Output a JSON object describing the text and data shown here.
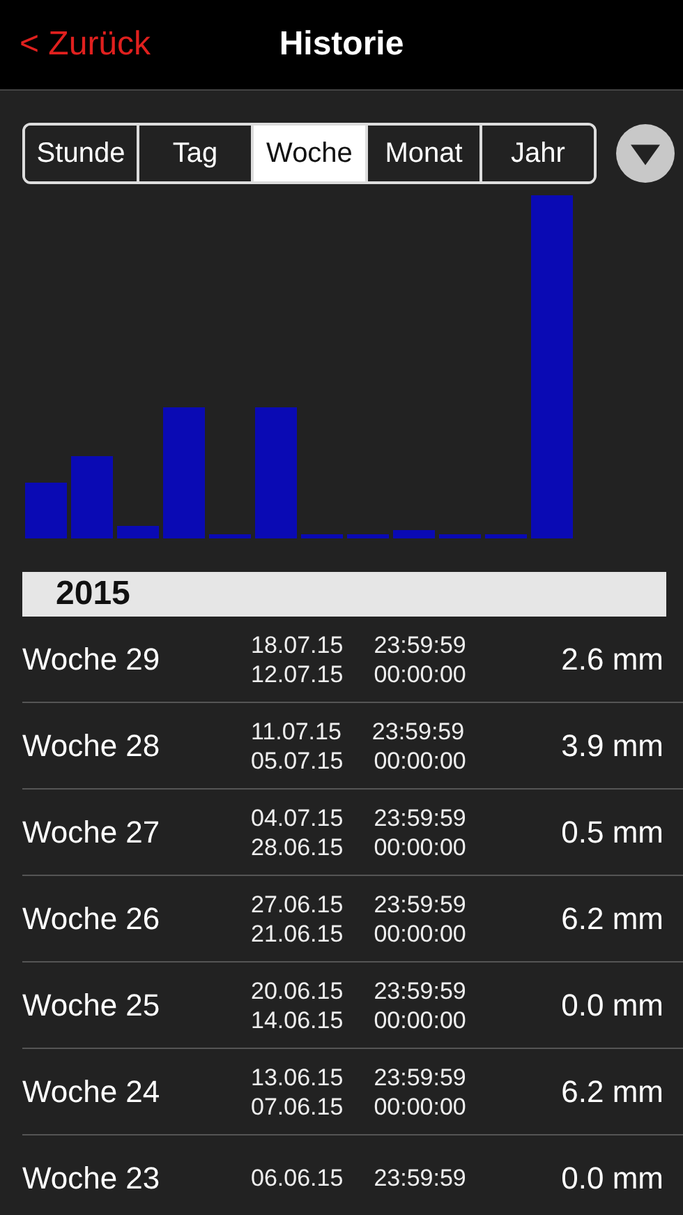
{
  "header": {
    "back": "< Zurück",
    "title": "Historie"
  },
  "tabs": [
    {
      "label": "Stunde",
      "selected": false
    },
    {
      "label": "Tag",
      "selected": false
    },
    {
      "label": "Woche",
      "selected": true
    },
    {
      "label": "Monat",
      "selected": false
    },
    {
      "label": "Jahr",
      "selected": false
    }
  ],
  "year": "2015",
  "rows": [
    {
      "name": "Woche 29",
      "end_date": "18.07.15",
      "end_time": "23:59:59",
      "start_date": "12.07.15",
      "start_time": "00:00:00",
      "value": "2.6 mm"
    },
    {
      "name": "Woche 28",
      "end_date": "11.07.15",
      "end_time": "23:59:59",
      "start_date": "05.07.15",
      "start_time": "00:00:00",
      "value": "3.9 mm"
    },
    {
      "name": "Woche 27",
      "end_date": "04.07.15",
      "end_time": "23:59:59",
      "start_date": "28.06.15",
      "start_time": "00:00:00",
      "value": "0.5 mm"
    },
    {
      "name": "Woche 26",
      "end_date": "27.06.15",
      "end_time": "23:59:59",
      "start_date": "21.06.15",
      "start_time": "00:00:00",
      "value": "6.2 mm"
    },
    {
      "name": "Woche 25",
      "end_date": "20.06.15",
      "end_time": "23:59:59",
      "start_date": "14.06.15",
      "start_time": "00:00:00",
      "value": "0.0 mm"
    },
    {
      "name": "Woche 24",
      "end_date": "13.06.15",
      "end_time": "23:59:59",
      "start_date": "07.06.15",
      "start_time": "00:00:00",
      "value": "6.2 mm"
    },
    {
      "name": "Woche 23",
      "end_date": "06.06.15",
      "end_time": "23:59:59",
      "value": "0.0 mm"
    }
  ]
}
